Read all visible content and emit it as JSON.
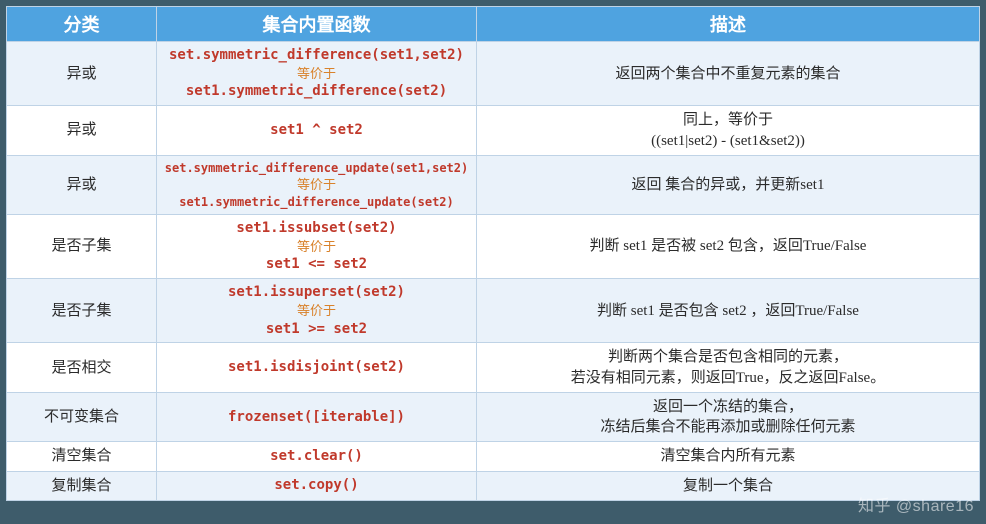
{
  "headers": {
    "h1": "分类",
    "h2": "集合内置函数",
    "h3": "描述"
  },
  "equiv": "等价于",
  "rows": [
    {
      "cat": "异或",
      "fn_a": "set.symmetric_difference(set1,set2)",
      "fn_b": "set1.symmetric_difference(set2)",
      "desc": "返回两个集合中不重复元素的集合"
    },
    {
      "cat": "异或",
      "fn_a": "set1 ^ set2",
      "desc": "同上，等价于\n((set1|set2) - (set1&set2))"
    },
    {
      "cat": "异或",
      "fn_a": "set.symmetric_difference_update(set1,set2)",
      "fn_b": "set1.symmetric_difference_update(set2)",
      "small": true,
      "desc": "返回 集合的异或，并更新set1"
    },
    {
      "cat": "是否子集",
      "fn_a": "set1.issubset(set2)",
      "fn_b": "set1 <= set2",
      "desc": "判断 set1 是否被 set2 包含，返回True/False"
    },
    {
      "cat": "是否子集",
      "fn_a": "set1.issuperset(set2)",
      "fn_b": "set1 >= set2",
      "desc": "判断 set1 是否包含 set2 ，返回True/False"
    },
    {
      "cat": "是否相交",
      "fn_a": "set1.isdisjoint(set2)",
      "desc": "判断两个集合是否包含相同的元素，\n若没有相同元素，则返回True，反之返回False。"
    },
    {
      "cat": "不可变集合",
      "fn_a": "frozenset([iterable])",
      "desc": "返回一个冻结的集合，\n冻结后集合不能再添加或删除任何元素"
    },
    {
      "cat": "清空集合",
      "fn_a": "set.clear()",
      "desc": "清空集合内所有元素"
    },
    {
      "cat": "复制集合",
      "fn_a": "set.copy()",
      "desc": "复制一个集合"
    }
  ],
  "watermark": "知乎 @share16"
}
